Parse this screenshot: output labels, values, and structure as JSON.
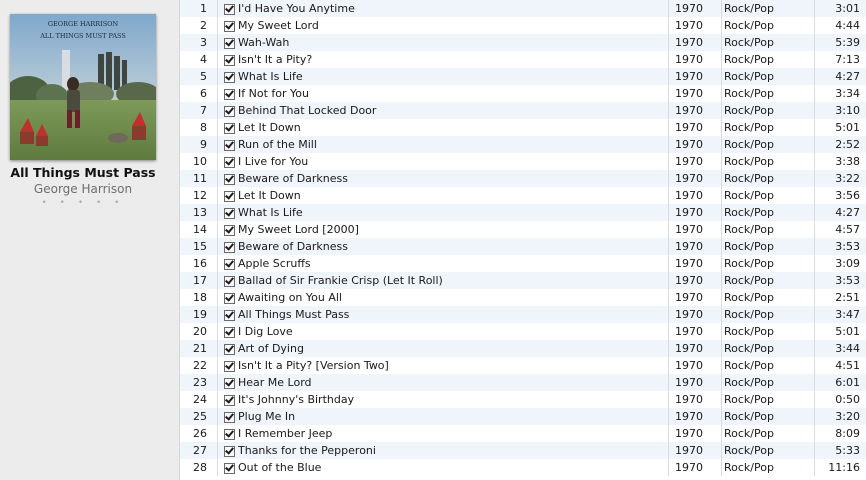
{
  "album": {
    "cover_title_line1": "GEORGE HARRISON",
    "cover_title_line2": "ALL THINGS MUST PASS",
    "title": "All Things Must Pass",
    "artist": "George Harrison",
    "rating_stars": 0,
    "rating_glyphs": "• • • • •"
  },
  "tracks": [
    {
      "num": "1",
      "checked": true,
      "name": "I'd Have You Anytime",
      "year": "1970",
      "genre": "Rock/Pop",
      "time": "3:01"
    },
    {
      "num": "2",
      "checked": true,
      "name": "My Sweet Lord",
      "year": "1970",
      "genre": "Rock/Pop",
      "time": "4:44"
    },
    {
      "num": "3",
      "checked": true,
      "name": "Wah-Wah",
      "year": "1970",
      "genre": "Rock/Pop",
      "time": "5:39"
    },
    {
      "num": "4",
      "checked": true,
      "name": "Isn't It a Pity?",
      "year": "1970",
      "genre": "Rock/Pop",
      "time": "7:13"
    },
    {
      "num": "5",
      "checked": true,
      "name": "What Is Life",
      "year": "1970",
      "genre": "Rock/Pop",
      "time": "4:27"
    },
    {
      "num": "6",
      "checked": true,
      "name": "If Not for You",
      "year": "1970",
      "genre": "Rock/Pop",
      "time": "3:34"
    },
    {
      "num": "7",
      "checked": true,
      "name": "Behind That Locked Door",
      "year": "1970",
      "genre": "Rock/Pop",
      "time": "3:10"
    },
    {
      "num": "8",
      "checked": true,
      "name": "Let It Down",
      "year": "1970",
      "genre": "Rock/Pop",
      "time": "5:01"
    },
    {
      "num": "9",
      "checked": true,
      "name": "Run of the Mill",
      "year": "1970",
      "genre": "Rock/Pop",
      "time": "2:52"
    },
    {
      "num": "10",
      "checked": true,
      "name": "I Live for You",
      "year": "1970",
      "genre": "Rock/Pop",
      "time": "3:38"
    },
    {
      "num": "11",
      "checked": true,
      "name": "Beware of Darkness",
      "year": "1970",
      "genre": "Rock/Pop",
      "time": "3:22"
    },
    {
      "num": "12",
      "checked": true,
      "name": "Let It Down",
      "year": "1970",
      "genre": "Rock/Pop",
      "time": "3:56"
    },
    {
      "num": "13",
      "checked": true,
      "name": "What Is Life",
      "year": "1970",
      "genre": "Rock/Pop",
      "time": "4:27"
    },
    {
      "num": "14",
      "checked": true,
      "name": "My Sweet Lord [2000]",
      "year": "1970",
      "genre": "Rock/Pop",
      "time": "4:57"
    },
    {
      "num": "15",
      "checked": true,
      "name": "Beware of Darkness",
      "year": "1970",
      "genre": "Rock/Pop",
      "time": "3:53"
    },
    {
      "num": "16",
      "checked": true,
      "name": "Apple Scruffs",
      "year": "1970",
      "genre": "Rock/Pop",
      "time": "3:09"
    },
    {
      "num": "17",
      "checked": true,
      "name": "Ballad of Sir Frankie Crisp (Let It Roll)",
      "year": "1970",
      "genre": "Rock/Pop",
      "time": "3:53"
    },
    {
      "num": "18",
      "checked": true,
      "name": "Awaiting on You All",
      "year": "1970",
      "genre": "Rock/Pop",
      "time": "2:51"
    },
    {
      "num": "19",
      "checked": true,
      "name": "All Things Must Pass",
      "year": "1970",
      "genre": "Rock/Pop",
      "time": "3:47"
    },
    {
      "num": "20",
      "checked": true,
      "name": "I Dig Love",
      "year": "1970",
      "genre": "Rock/Pop",
      "time": "5:01"
    },
    {
      "num": "21",
      "checked": true,
      "name": "Art of Dying",
      "year": "1970",
      "genre": "Rock/Pop",
      "time": "3:44"
    },
    {
      "num": "22",
      "checked": true,
      "name": "Isn't It a Pity? [Version Two]",
      "year": "1970",
      "genre": "Rock/Pop",
      "time": "4:51"
    },
    {
      "num": "23",
      "checked": true,
      "name": "Hear Me Lord",
      "year": "1970",
      "genre": "Rock/Pop",
      "time": "6:01"
    },
    {
      "num": "24",
      "checked": true,
      "name": "It's Johnny's Birthday",
      "year": "1970",
      "genre": "Rock/Pop",
      "time": "0:50"
    },
    {
      "num": "25",
      "checked": true,
      "name": "Plug Me In",
      "year": "1970",
      "genre": "Rock/Pop",
      "time": "3:20"
    },
    {
      "num": "26",
      "checked": true,
      "name": "I Remember Jeep",
      "year": "1970",
      "genre": "Rock/Pop",
      "time": "8:09"
    },
    {
      "num": "27",
      "checked": true,
      "name": "Thanks for the Pepperoni",
      "year": "1970",
      "genre": "Rock/Pop",
      "time": "5:33"
    },
    {
      "num": "28",
      "checked": true,
      "name": "Out of the Blue",
      "year": "1970",
      "genre": "Rock/Pop",
      "time": "11:16"
    }
  ],
  "colors": {
    "row_alt": "#f0f4fb",
    "panel_bg": "#ececec"
  }
}
